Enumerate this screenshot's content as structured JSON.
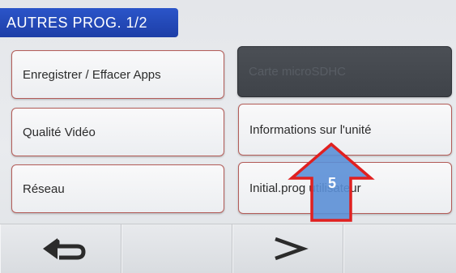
{
  "header": {
    "title": "AUTRES PROG. 1/2"
  },
  "buttons": {
    "save_apps": "Enregistrer / Effacer Apps",
    "microsd": "Carte microSDHC",
    "video_quality": "Qualité Vidéo",
    "unit_info": "Informations sur l'unité",
    "network": "Réseau",
    "init_user": "Initial.prog utilisateur"
  },
  "footer": {
    "back_icon": "back-arrow-icon",
    "next_icon": "chevron-right-icon"
  },
  "annotation": {
    "step_number": "5"
  },
  "colors": {
    "header_blue": "#2149b8",
    "button_border": "#b45d59",
    "annotation_arrow_fill": "#5b8fd6",
    "annotation_arrow_border": "#e02020"
  }
}
